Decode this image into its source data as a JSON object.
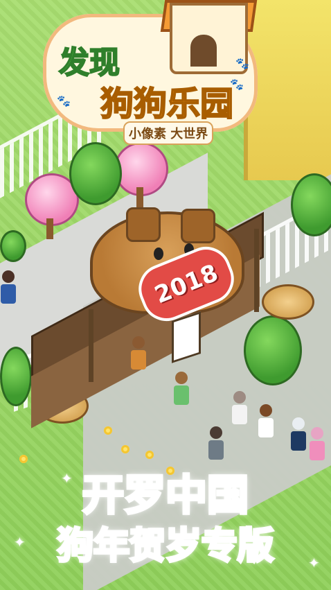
{
  "game": {
    "logo": {
      "title_line1": "发现",
      "title_line2": "狗狗乐园",
      "subtitle": "小像素 大世界"
    },
    "scene": {
      "year_badge": "2018"
    },
    "banner": {
      "line1": "开罗中国",
      "line2": "狗年贺岁专版"
    }
  },
  "colors": {
    "grass": "#9fd86a",
    "pink": "#ff69b4",
    "orange": "#ff9e20",
    "wood": "#8a6440"
  },
  "icons": [
    "paw-icon",
    "sparkle-icon",
    "dog-icon",
    "doghouse-icon"
  ]
}
